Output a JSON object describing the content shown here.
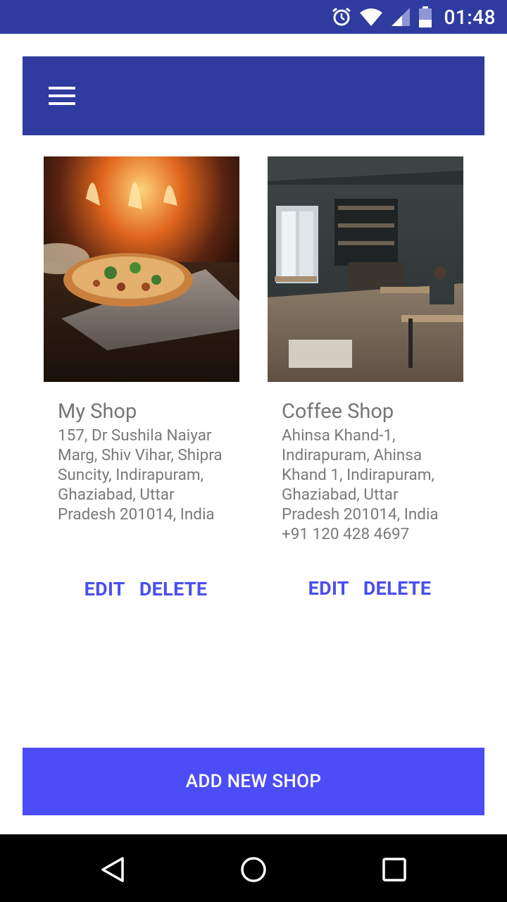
{
  "status_bar": {
    "time": "01:48",
    "icons": [
      "alarm-icon",
      "wifi-icon",
      "signal-icon",
      "battery-icon"
    ]
  },
  "toolbar": {
    "menu_icon": "hamburger-menu-icon"
  },
  "shops": [
    {
      "name": "My Shop",
      "address": "157, Dr Sushila Naiyar Marg, Shiv Vihar, Shipra Suncity, Indirapuram, Ghaziabad, Uttar Pradesh 201014, India",
      "image": "pizza-photo",
      "edit_label": "EDIT",
      "delete_label": "DELETE"
    },
    {
      "name": "Coffee Shop",
      "address": "Ahinsa Khand-1, Indirapuram, Ahinsa Khand 1, Indirapuram, Ghaziabad, Uttar Pradesh 201014, India",
      "phone": "+91 120 428 4697",
      "image": "cafe-interior-photo",
      "edit_label": "EDIT",
      "delete_label": "DELETE"
    }
  ],
  "add_button_label": "ADD NEW SHOP",
  "nav_bar": {
    "icons": [
      "back-icon",
      "home-icon",
      "recents-icon"
    ]
  },
  "colors": {
    "primary": "#2f3b9f",
    "accent": "#4d4df7",
    "action_text": "#4a4fef"
  }
}
